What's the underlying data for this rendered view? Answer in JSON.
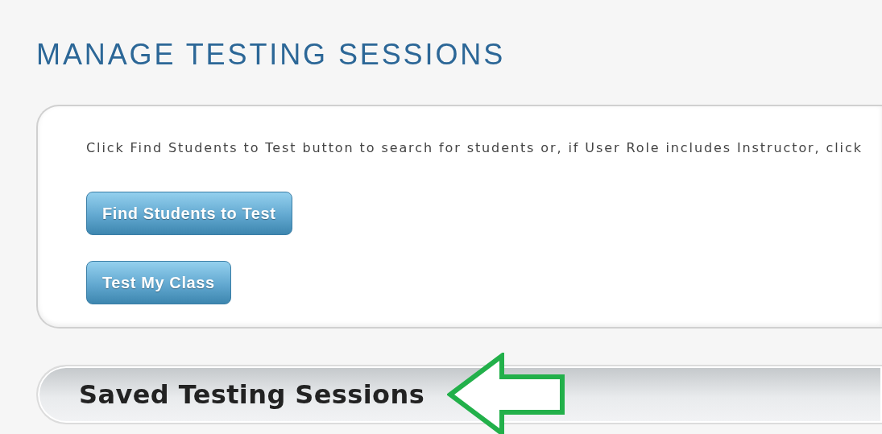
{
  "page": {
    "title": "MANAGE TESTING SESSIONS"
  },
  "panel": {
    "instructions": "Click Find Students to Test button to search for students or, if User Role includes Instructor, click",
    "buttons": [
      {
        "label": "Find Students to Test"
      },
      {
        "label": "Test My Class"
      }
    ]
  },
  "saved_sessions": {
    "heading": "Saved Testing Sessions"
  }
}
